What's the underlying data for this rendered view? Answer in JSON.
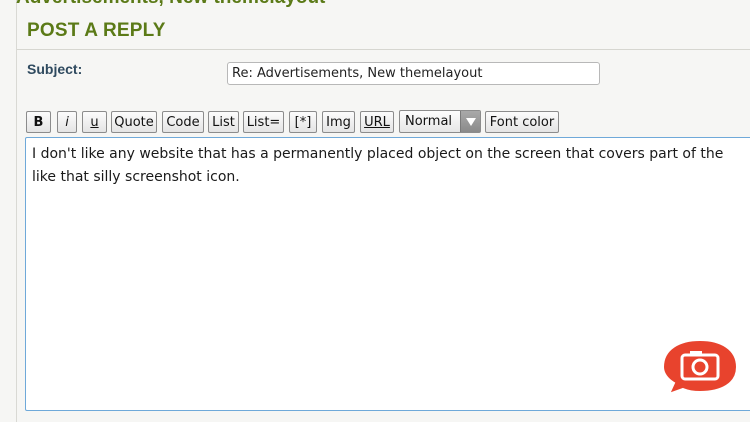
{
  "topic_title": "Advertisements, New themelayout",
  "form": {
    "heading": "POST A REPLY",
    "subject_label": "Subject:",
    "subject_value": "Re: Advertisements, New themelayout"
  },
  "toolbar": {
    "bold": "B",
    "italic": "i",
    "underline": "u",
    "quote": "Quote",
    "code": "Code",
    "list": "List",
    "list_ordered": "List=",
    "list_item": "[*]",
    "img": "Img",
    "url": "URL",
    "font_size": "Normal",
    "font_color": "Font color"
  },
  "message": {
    "lines": [
      "I don't like any website that has a permanently placed object on the screen that covers part of the",
      "like that silly screenshot icon."
    ]
  },
  "icons": {
    "screenshot": "camera-icon",
    "dropdown": "chevron-down-icon"
  },
  "colors": {
    "heading_green": "#5b7a17",
    "label_blue": "#2f4a5f",
    "textarea_border": "#6fa9d9",
    "camera_red": "#e8432d"
  }
}
